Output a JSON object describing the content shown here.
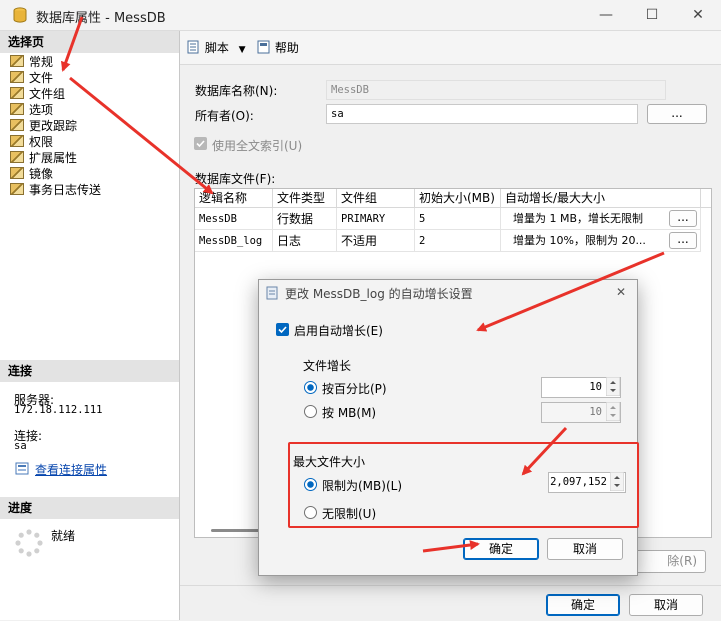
{
  "window": {
    "title": "数据库属性 - MessDB",
    "minimize": "—",
    "maximize": "☐",
    "close": "✕"
  },
  "left_pane": {
    "select_page_header": "选择页",
    "pages": [
      "常规",
      "文件",
      "文件组",
      "选项",
      "更改跟踪",
      "权限",
      "扩展属性",
      "镜像",
      "事务日志传送"
    ],
    "connection_header": "连接",
    "server_label": "服务器:",
    "server_value": "172.18.112.111",
    "connection_label": "连接:",
    "connection_value": "sa",
    "view_connection_link": "查看连接属性",
    "progress_header": "进度",
    "progress_status": "就绪"
  },
  "toolbar": {
    "script_label": "脚本",
    "help_label": "帮助"
  },
  "main": {
    "db_name_label": "数据库名称(N):",
    "db_name_value": "MessDB",
    "owner_label": "所有者(O):",
    "owner_value": "sa",
    "owner_browse": "...",
    "fulltext_label": "使用全文索引(U)",
    "files_label": "数据库文件(F):",
    "columns": [
      "逻辑名称",
      "文件类型",
      "文件组",
      "初始大小(MB)",
      "自动增长/最大大小"
    ],
    "rows": [
      {
        "name": "MessDB",
        "type": "行数据",
        "group": "PRIMARY",
        "size": "5",
        "growth": "增量为 1 MB，增长无限制",
        "btn": "..."
      },
      {
        "name": "MessDB_log",
        "type": "日志",
        "group": "不适用",
        "size": "2",
        "growth": "增量为 10%，限制为 20...",
        "btn": "..."
      }
    ],
    "remove_button_partial": "除(R)"
  },
  "footer": {
    "ok": "确定",
    "cancel": "取消"
  },
  "dialog": {
    "title": "更改 MessDB_log 的自动增长设置",
    "close": "✕",
    "enable_autogrowth": "启用自动增长(E)",
    "file_growth_label": "文件增长",
    "by_percent": "按百分比(P)",
    "percent_value": "10",
    "by_mb": "按 MB(M)",
    "mb_value": "10",
    "max_size_label": "最大文件大小",
    "limit_to": "限制为(MB)(L)",
    "limit_value": "2,097,152",
    "unlimited": "无限制(U)",
    "ok": "确定",
    "cancel": "取消"
  },
  "colors": {
    "accent": "#0067c0",
    "annotation": "#e8322a"
  }
}
